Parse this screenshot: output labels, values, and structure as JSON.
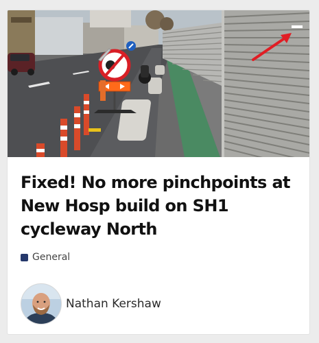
{
  "topic": {
    "title": "Fixed! No more pinchpoints at New Hosp build on SH1 cycleway North",
    "category": {
      "label": "General",
      "color": "#25386b"
    },
    "author": {
      "name": "Nathan Kershaw"
    }
  },
  "colors": {
    "card_bg": "#ffffff",
    "page_bg": "#ececec",
    "arrow_red": "#e11d24",
    "sign_red": "#d81f26",
    "sign_blue": "#1f5fbf",
    "cycle_lane_green": "#4a8a62"
  },
  "icons": {
    "arrow": "red-arrow-annotation",
    "sign": "no-overtaking-sign"
  }
}
